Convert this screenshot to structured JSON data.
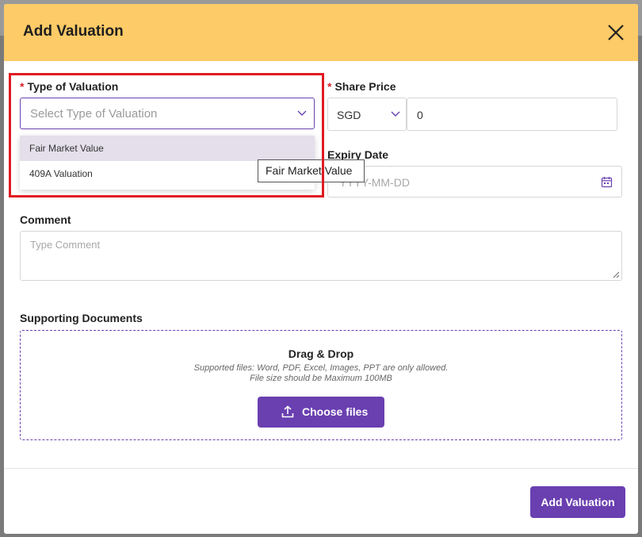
{
  "modal": {
    "title": "Add Valuation",
    "close_icon": "close-icon"
  },
  "type_of_valuation": {
    "label": "Type of Valuation",
    "required_mark": "*",
    "placeholder": "Select Type of Valuation",
    "options": [
      "Fair Market Value",
      "409A Valuation"
    ],
    "highlighted_option": "Fair Market Value"
  },
  "tooltip": {
    "text": "Fair Market Value"
  },
  "share_price": {
    "label": "Share Price",
    "required_mark": "*",
    "currency": "SGD",
    "value": "0"
  },
  "expiry_date": {
    "label": "Expiry Date",
    "placeholder": "YYYY-MM-DD",
    "icon": "calendar-icon"
  },
  "comment": {
    "label": "Comment",
    "placeholder": "Type Comment"
  },
  "supporting_documents": {
    "label": "Supporting Documents",
    "dropzone_title": "Drag & Drop",
    "supported_text": "Supported files: Word, PDF, Excel, Images, PPT are only allowed.",
    "size_text": "File size should be Maximum 100MB",
    "choose_label": "Choose files",
    "upload_icon": "upload-icon"
  },
  "footer": {
    "submit_label": "Add Valuation"
  },
  "colors": {
    "header": "#fdcb67",
    "accent": "#6a3fb0",
    "required": "#d9232d",
    "highlight_outline": "#e01b22",
    "option_hover": "#e4dfeb"
  }
}
